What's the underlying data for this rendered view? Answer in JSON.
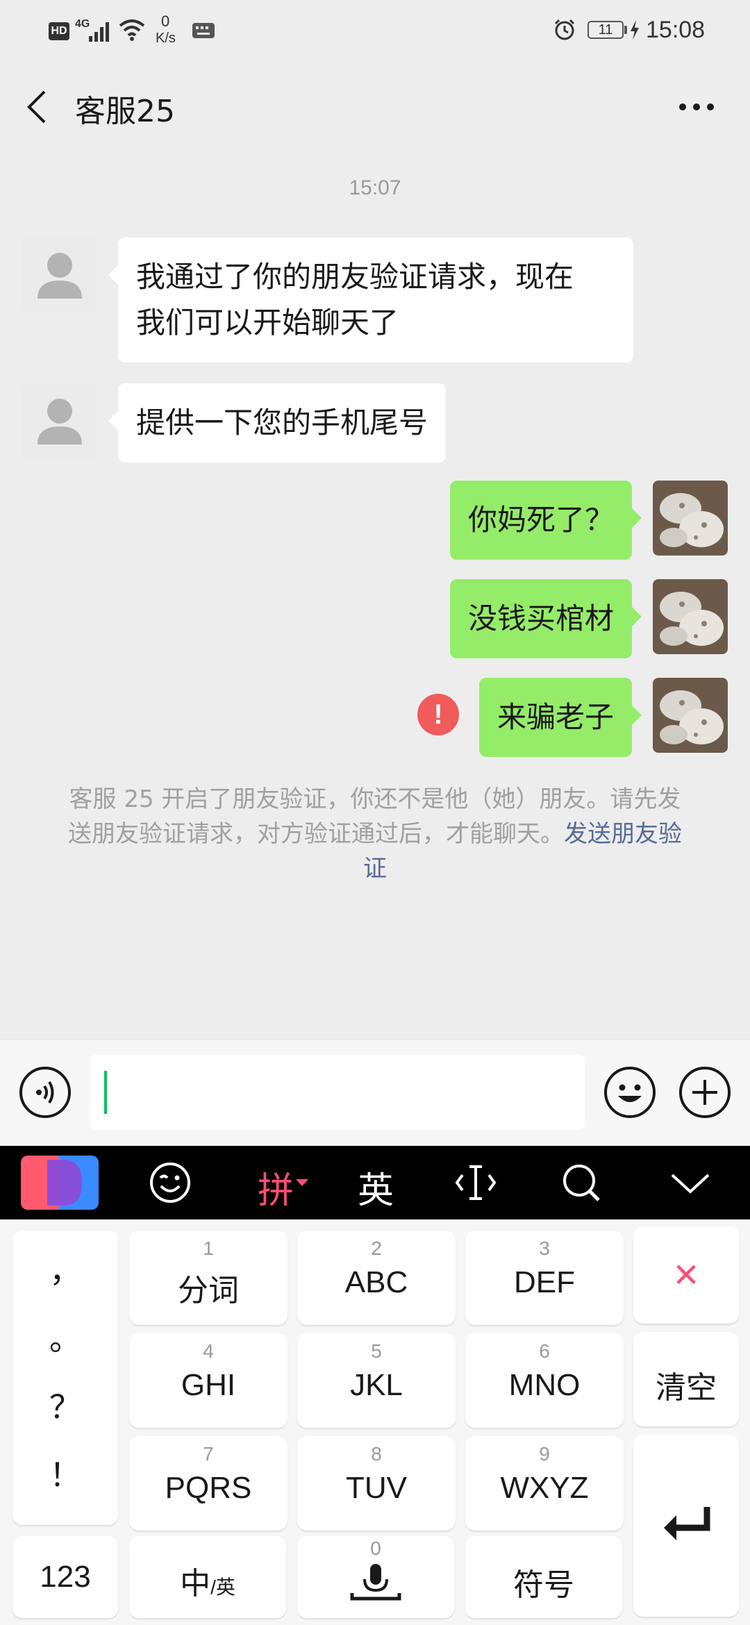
{
  "status_bar": {
    "hd": "HD",
    "network": "4G",
    "speed_value": "0",
    "speed_unit": "K/s",
    "battery": "11",
    "time": "15:08"
  },
  "nav": {
    "title": "客服25",
    "back_icon": "chevron-left-icon",
    "more_icon": "more-icon"
  },
  "chat": {
    "timestamp": "15:07",
    "messages": [
      {
        "side": "in",
        "lines": [
          "我通过了你的朋友验证请求，现在",
          "我们可以开始聊天了"
        ]
      },
      {
        "side": "in",
        "lines": [
          "提供一下您的手机尾号"
        ]
      },
      {
        "side": "out",
        "lines": [
          "你妈死了？"
        ]
      },
      {
        "side": "out",
        "lines": [
          "没钱买棺材"
        ]
      },
      {
        "side": "out",
        "lines": [
          "来骗老子"
        ],
        "failed": true
      }
    ],
    "error_mark": "!",
    "system_notice": {
      "text": "客服 25 开启了朋友验证，你还不是他（她）朋友。请先发送朋友验证请求，对方验证通过后，才能聊天。",
      "link": "发送朋友验证"
    }
  },
  "input_bar": {
    "voice_icon": "voice-icon",
    "emoji_icon": "emoji-icon",
    "plus_icon": "plus-icon",
    "value": ""
  },
  "keyboard": {
    "toolbar": {
      "logo": "ime-logo",
      "emoji_icon": "emoji-icon",
      "pinyin": "拼",
      "english": "英",
      "cursor_icon": "cursor-icon",
      "search_icon": "search-icon",
      "collapse_icon": "chevron-down-icon"
    },
    "punctuation": [
      "，",
      "。",
      "？",
      "！"
    ],
    "keys": [
      {
        "num": "1",
        "label": "分词"
      },
      {
        "num": "2",
        "label": "ABC"
      },
      {
        "num": "3",
        "label": "DEF"
      },
      {
        "num": "4",
        "label": "GHI"
      },
      {
        "num": "5",
        "label": "JKL"
      },
      {
        "num": "6",
        "label": "MNO"
      },
      {
        "num": "7",
        "label": "PQRS"
      },
      {
        "num": "8",
        "label": "TUV"
      },
      {
        "num": "9",
        "label": "WXYZ"
      }
    ],
    "delete_label": "×",
    "clear_label": "清空",
    "bottom": {
      "numbers": "123",
      "lang_main": "中",
      "lang_sub": "/英",
      "space_num": "0",
      "symbols": "符号"
    },
    "colors": {
      "accent": "#ff4d75",
      "toolbar_bg": "#000000",
      "sent_bubble": "#95ec69",
      "error": "#f05b5b"
    }
  }
}
